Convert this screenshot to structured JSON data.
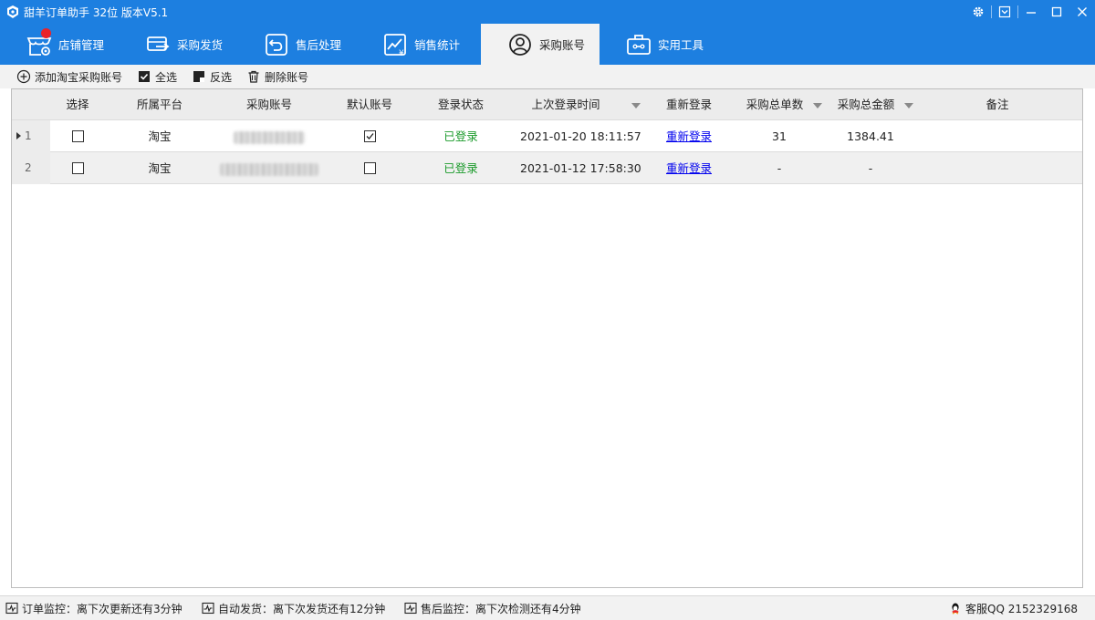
{
  "window": {
    "title": "甜羊订单助手 32位  版本V5.1",
    "accent_color": "#1d7fe0"
  },
  "tabs": [
    {
      "label": "店铺管理",
      "icon": "store-settings-icon",
      "has_badge": true
    },
    {
      "label": "采购发货",
      "icon": "truck-icon"
    },
    {
      "label": "售后处理",
      "icon": "return-icon"
    },
    {
      "label": "销售统计",
      "icon": "trend-chart-icon"
    },
    {
      "label": "采购账号",
      "icon": "user-icon",
      "active": true
    },
    {
      "label": "实用工具",
      "icon": "toolbox-icon"
    }
  ],
  "toolbar": {
    "add_label": "添加淘宝采购账号",
    "select_all_label": "全选",
    "invert_label": "反选",
    "delete_label": "删除账号"
  },
  "table": {
    "headers": {
      "select": "选择",
      "platform": "所属平台",
      "account": "采购账号",
      "default": "默认账号",
      "status": "登录状态",
      "last_login": "上次登录时间",
      "relogin": "重新登录",
      "order_count": "采购总单数",
      "total_amount": "采购总金额",
      "remark": "备注"
    },
    "rows": [
      {
        "num": "1",
        "current": true,
        "selected": false,
        "platform": "淘宝",
        "account_blurred": true,
        "is_default": true,
        "status": "已登录",
        "last_login": "2021-01-20 18:11:57",
        "relogin": "重新登录",
        "order_count": "31",
        "total_amount": "1384.41",
        "remark": ""
      },
      {
        "num": "2",
        "current": false,
        "selected": false,
        "platform": "淘宝",
        "account_blurred": true,
        "is_default": false,
        "status": "已登录",
        "last_login": "2021-01-12 17:58:30",
        "relogin": "重新登录",
        "order_count": "-",
        "total_amount": "-",
        "remark": ""
      }
    ]
  },
  "statusbar": {
    "order_monitor": "订单监控：离下次更新还有3分钟",
    "auto_ship": "自动发货：离下次发货还有12分钟",
    "after_sale_monitor": "售后监控：离下次检测还有4分钟",
    "service_qq": "客服QQ 2152329168"
  }
}
